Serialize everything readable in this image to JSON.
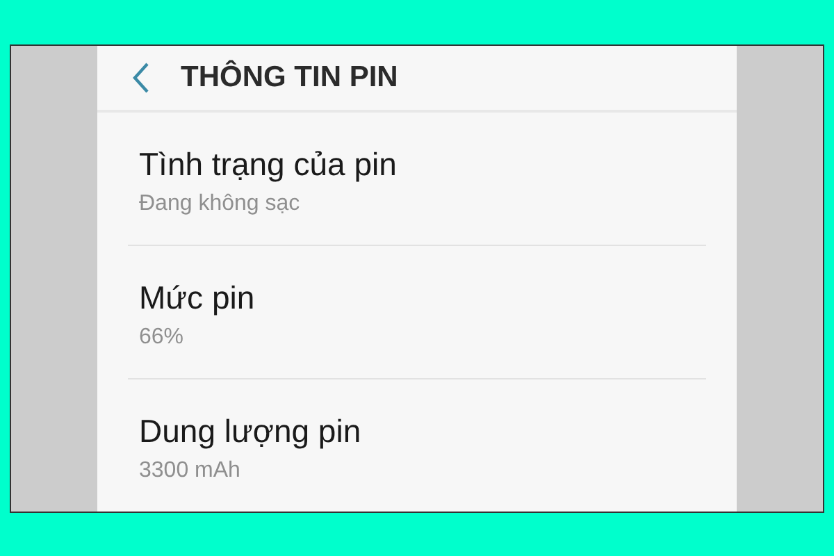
{
  "header": {
    "title": "THÔNG TIN PIN"
  },
  "items": [
    {
      "title": "Tình trạng của pin",
      "value": "Đang không sạc"
    },
    {
      "title": "Mức pin",
      "value": "66%"
    },
    {
      "title": "Dung lượng pin",
      "value": "3300 mAh"
    }
  ]
}
